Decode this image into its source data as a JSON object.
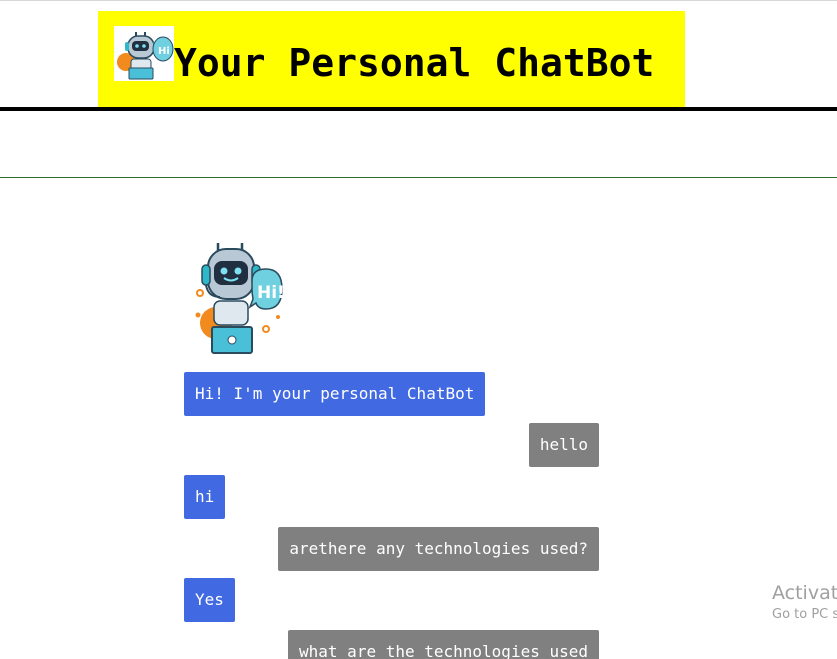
{
  "header": {
    "title": "Your Personal ChatBot",
    "background": "#ffff00",
    "logo_icon": "robot-hi-icon"
  },
  "chat": {
    "avatar_icon": "robot-hi-icon",
    "bot_color": "#4169e1",
    "user_color": "#808080",
    "messages": [
      {
        "sender": "bot",
        "text": "Hi! I'm your personal ChatBot"
      },
      {
        "sender": "user",
        "text": "hello"
      },
      {
        "sender": "bot",
        "text": "hi"
      },
      {
        "sender": "user",
        "text": "arethere any technologies used?"
      },
      {
        "sender": "bot",
        "text": "Yes"
      },
      {
        "sender": "user",
        "text": "what are the technologies used"
      }
    ]
  },
  "watermark": {
    "title": "Activate Windows",
    "subtitle": "Go to PC settings to activate Windows."
  }
}
